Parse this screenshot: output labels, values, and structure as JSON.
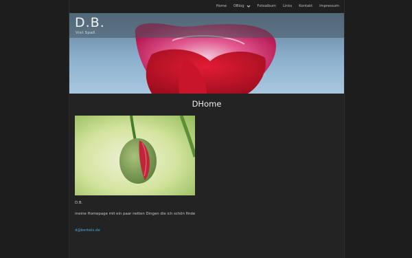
{
  "nav": {
    "items": [
      {
        "label": "Home"
      },
      {
        "label": "DBlog",
        "has_dropdown": true
      },
      {
        "label": "Fotoalbum"
      },
      {
        "label": "Links"
      },
      {
        "label": "Kontakt"
      },
      {
        "label": "Impressum"
      }
    ]
  },
  "header": {
    "site_title": "D.B.",
    "subtitle": "Viel Spaß"
  },
  "main": {
    "page_title": "DHome",
    "caption": "D.B.",
    "description": "meine Homepage mit ein paar netten Dingen die ich schön finde",
    "email": "d@berkels.de"
  },
  "colors": {
    "link": "#4fa6d8",
    "background": "#232323"
  },
  "icons": {
    "dropdown": "chevron-down-icon"
  }
}
